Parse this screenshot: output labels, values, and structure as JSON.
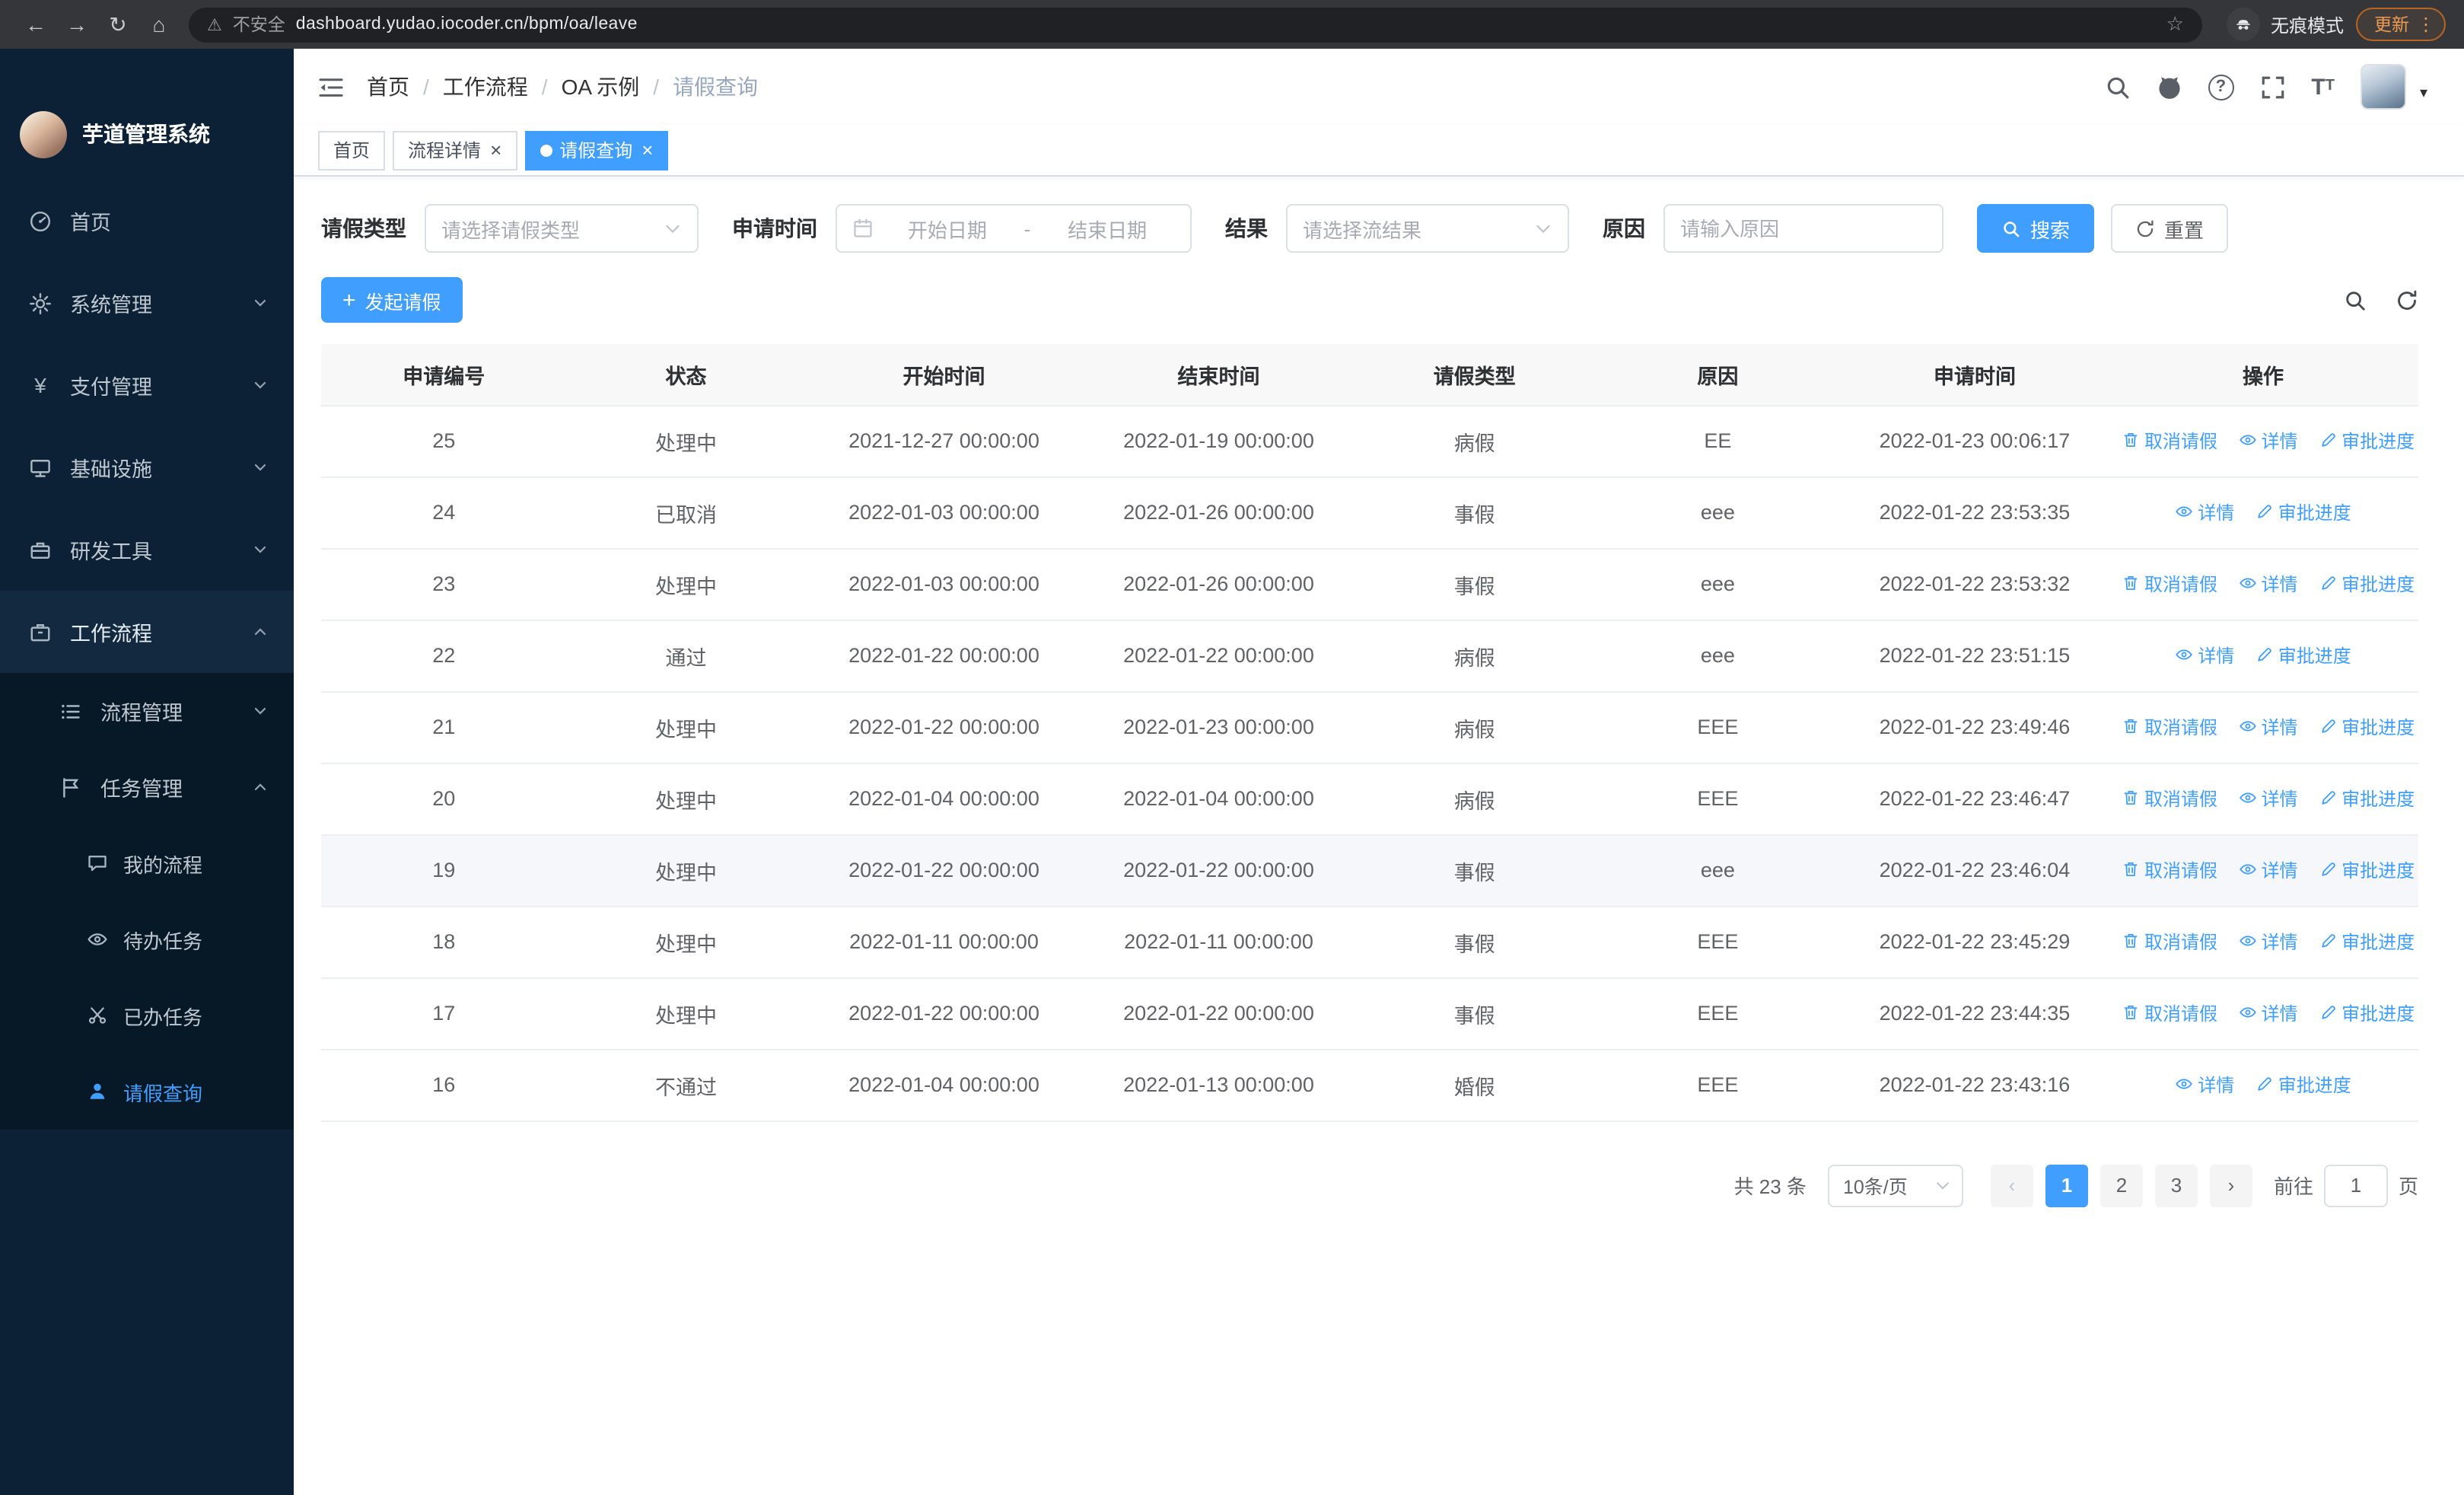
{
  "browser": {
    "security_label": "不安全",
    "url": "dashboard.yudao.iocoder.cn/bpm/oa/leave",
    "incognito_label": "无痕模式",
    "update_label": "更新"
  },
  "icons": {
    "back": "←",
    "forward": "→",
    "reload": "↻",
    "home": "⌂",
    "warning": "⚠",
    "star": "☆",
    "menu_dots": "⋮",
    "close": "×",
    "prev": "‹",
    "next": "›",
    "plus": "+",
    "caret": "▾"
  },
  "sidebar": {
    "logo_title": "芋道管理系统",
    "items": [
      "首页",
      "系统管理",
      "支付管理",
      "基础设施",
      "研发工具",
      "工作流程",
      "流程管理",
      "任务管理",
      "我的流程",
      "待办任务",
      "已办任务",
      "请假查询"
    ]
  },
  "header": {
    "breadcrumbs": [
      "首页",
      "工作流程",
      "OA 示例",
      "请假查询"
    ]
  },
  "tabs": [
    {
      "label": "首页"
    },
    {
      "label": "流程详情"
    },
    {
      "label": "请假查询"
    }
  ],
  "filters": {
    "type_label": "请假类型",
    "type_placeholder": "请选择请假类型",
    "time_label": "申请时间",
    "start_placeholder": "开始日期",
    "range_separator": "-",
    "end_placeholder": "结束日期",
    "result_label": "结果",
    "result_placeholder": "请选择流结果",
    "reason_label": "原因",
    "reason_placeholder": "请输入原因",
    "search_label": "搜索",
    "reset_label": "重置"
  },
  "toolbar": {
    "create_label": "发起请假"
  },
  "table": {
    "columns": [
      "申请编号",
      "状态",
      "开始时间",
      "结束时间",
      "请假类型",
      "原因",
      "申请时间",
      "操作"
    ],
    "rows": [
      {
        "id": "25",
        "status": "处理中",
        "start": "2021-12-27 00:00:00",
        "end": "2022-01-19 00:00:00",
        "type": "病假",
        "reason": "EE",
        "apply_time": "2022-01-23 00:06:17",
        "ops": [
          "cancel",
          "detail",
          "progress"
        ]
      },
      {
        "id": "24",
        "status": "已取消",
        "start": "2022-01-03 00:00:00",
        "end": "2022-01-26 00:00:00",
        "type": "事假",
        "reason": "eee",
        "apply_time": "2022-01-22 23:53:35",
        "ops": [
          "detail",
          "progress"
        ]
      },
      {
        "id": "23",
        "status": "处理中",
        "start": "2022-01-03 00:00:00",
        "end": "2022-01-26 00:00:00",
        "type": "事假",
        "reason": "eee",
        "apply_time": "2022-01-22 23:53:32",
        "ops": [
          "cancel",
          "detail",
          "progress"
        ]
      },
      {
        "id": "22",
        "status": "通过",
        "start": "2022-01-22 00:00:00",
        "end": "2022-01-22 00:00:00",
        "type": "病假",
        "reason": "eee",
        "apply_time": "2022-01-22 23:51:15",
        "ops": [
          "detail",
          "progress"
        ]
      },
      {
        "id": "21",
        "status": "处理中",
        "start": "2022-01-22 00:00:00",
        "end": "2022-01-23 00:00:00",
        "type": "病假",
        "reason": "EEE",
        "apply_time": "2022-01-22 23:49:46",
        "ops": [
          "cancel",
          "detail",
          "progress"
        ]
      },
      {
        "id": "20",
        "status": "处理中",
        "start": "2022-01-04 00:00:00",
        "end": "2022-01-04 00:00:00",
        "type": "病假",
        "reason": "EEE",
        "apply_time": "2022-01-22 23:46:47",
        "ops": [
          "cancel",
          "detail",
          "progress"
        ]
      },
      {
        "id": "19",
        "status": "处理中",
        "start": "2022-01-22 00:00:00",
        "end": "2022-01-22 00:00:00",
        "type": "事假",
        "reason": "eee",
        "apply_time": "2022-01-22 23:46:04",
        "ops": [
          "cancel",
          "detail",
          "progress"
        ],
        "highlight": true
      },
      {
        "id": "18",
        "status": "处理中",
        "start": "2022-01-11 00:00:00",
        "end": "2022-01-11 00:00:00",
        "type": "事假",
        "reason": "EEE",
        "apply_time": "2022-01-22 23:45:29",
        "ops": [
          "cancel",
          "detail",
          "progress"
        ]
      },
      {
        "id": "17",
        "status": "处理中",
        "start": "2022-01-22 00:00:00",
        "end": "2022-01-22 00:00:00",
        "type": "事假",
        "reason": "EEE",
        "apply_time": "2022-01-22 23:44:35",
        "ops": [
          "cancel",
          "detail",
          "progress"
        ]
      },
      {
        "id": "16",
        "status": "不通过",
        "start": "2022-01-04 00:00:00",
        "end": "2022-01-13 00:00:00",
        "type": "婚假",
        "reason": "EEE",
        "apply_time": "2022-01-22 23:43:16",
        "ops": [
          "detail",
          "progress"
        ]
      }
    ]
  },
  "ops": {
    "cancel": "取消请假",
    "detail": "详情",
    "progress": "审批进度"
  },
  "pagination": {
    "total": "共 23 条",
    "page_size": "10条/页",
    "pages": [
      "1",
      "2",
      "3"
    ],
    "goto_label": "前往",
    "goto_value": "1",
    "unit_label": "页"
  },
  "colors": {
    "accent": "#409eff",
    "sidebar_bg": "#0c2135",
    "chrome_bg": "#35363a"
  }
}
